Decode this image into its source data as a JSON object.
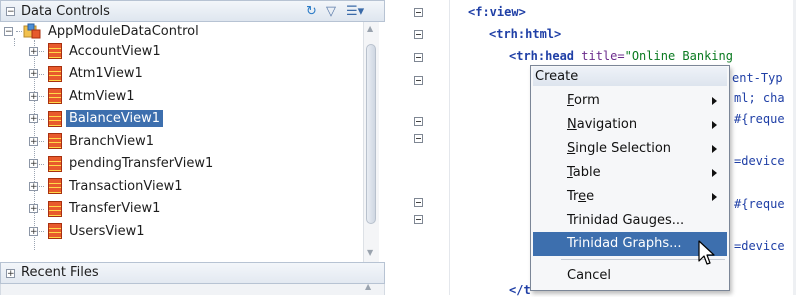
{
  "data_controls": {
    "title": "Data Controls",
    "root": "AppModuleDataControl",
    "items": [
      {
        "label": "AccountView1",
        "selected": false
      },
      {
        "label": "Atm1View1",
        "selected": false
      },
      {
        "label": "AtmView1",
        "selected": false
      },
      {
        "label": "BalanceView1",
        "selected": true
      },
      {
        "label": "BranchView1",
        "selected": false
      },
      {
        "label": "pendingTransferView1",
        "selected": false
      },
      {
        "label": "TransactionView1",
        "selected": false
      },
      {
        "label": "TransferView1",
        "selected": false
      },
      {
        "label": "UsersView1",
        "selected": false
      }
    ],
    "toolbar_icons": [
      "refresh-icon",
      "filter-icon",
      "view-options-icon"
    ]
  },
  "recent_files": {
    "title": "Recent Files"
  },
  "code": {
    "line1_tag": "<f:view>",
    "line2_tag": "<trh:html>",
    "line3_tag": "<trh:head",
    "line3_attr": " title=",
    "line3_str": "\"Online Banking",
    "frag_ent_typ": "ent-Typ",
    "frag_ml_cha": "ml; cha",
    "frag_reque_1": "#{reque",
    "frag_device_1": "=device",
    "frag_reque_2": "#{reque",
    "frag_device_2": "=device",
    "frag_close": "</t"
  },
  "context_menu": {
    "title": "Create",
    "items": [
      {
        "label": "Form",
        "submenu": true,
        "mnemonic": "F"
      },
      {
        "label": "Navigation",
        "submenu": true,
        "mnemonic": "N"
      },
      {
        "label": "Single Selection",
        "submenu": true,
        "mnemonic": "S"
      },
      {
        "label": "Table",
        "submenu": true,
        "mnemonic": "T"
      },
      {
        "label": "Tree",
        "submenu": true,
        "mnemonic": "e"
      },
      {
        "label": "Trinidad Gauges...",
        "submenu": false
      },
      {
        "label": "Trinidad Graphs...",
        "submenu": false,
        "hover": true
      },
      {
        "label": "Cancel",
        "submenu": false
      }
    ]
  },
  "colors": {
    "selection": "#3d6fae",
    "code_tag": "#1f3fa6",
    "code_attr": "#6b2c8c",
    "code_string": "#0a7a20"
  }
}
